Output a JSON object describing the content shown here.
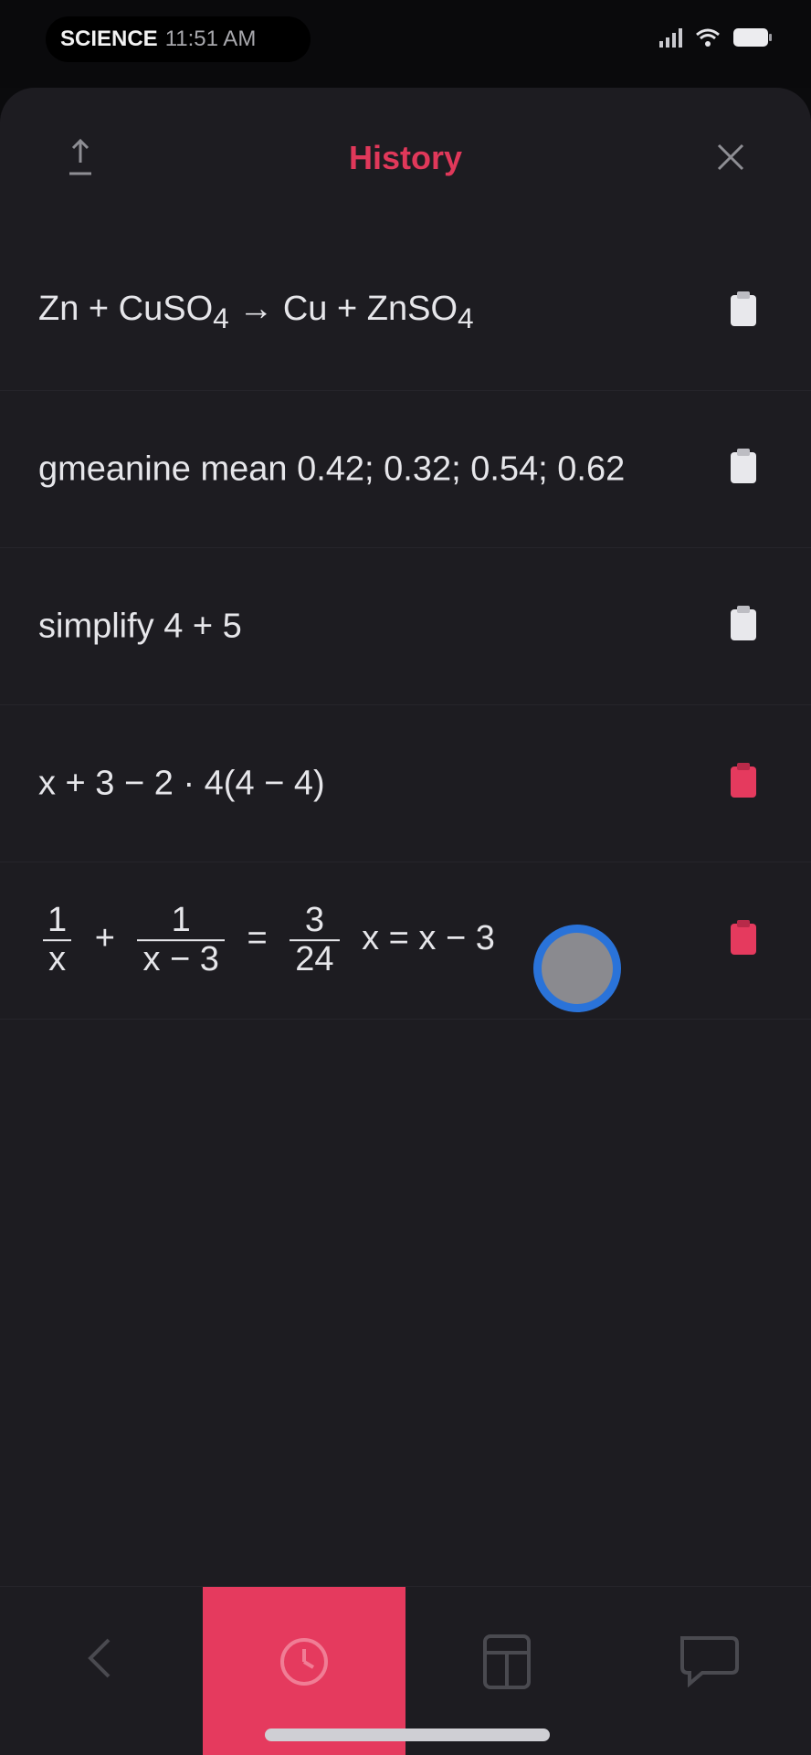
{
  "status_bar": {
    "app_name": "SCIENCE",
    "time_label": "11:51 AM",
    "icons": [
      "signal-icon",
      "wifi-icon",
      "battery-icon"
    ]
  },
  "header": {
    "title": "History",
    "left_icon": "upload-icon",
    "right_icon": "close-icon"
  },
  "history": {
    "items": [
      {
        "expr_parts": [
          "Zn + CuSO",
          "4",
          " → Cu + ZnSO",
          "4"
        ],
        "action_icon": "copy-icon",
        "action_color": "#e8e8ec"
      },
      {
        "expr": "gmeanine mean 0.42; 0.32; 0.54; 0.62",
        "action_icon": "copy-icon",
        "action_color": "#e8e8ec"
      },
      {
        "expr": "simplify 4 + 5",
        "action_icon": "copy-icon",
        "action_color": "#e8e8ec"
      },
      {
        "expr": "x + 3 − 2 · 4(4 − 4)",
        "action_icon": "delete-icon",
        "action_color": "#e53a5e"
      },
      {
        "frac1": {
          "num": "1",
          "den": "x"
        },
        "op1": "+",
        "frac2": {
          "num": "1",
          "den": "x − 3"
        },
        "op2": "=",
        "frac3": {
          "num": "3",
          "den": "24"
        },
        "tail": "x = x − 3",
        "action_icon": "delete-icon",
        "action_color": "#e53a5e"
      }
    ]
  },
  "bottom_nav": {
    "items": [
      {
        "icon": "back-icon",
        "active": false
      },
      {
        "icon": "history-icon",
        "active": true
      },
      {
        "icon": "calculator-icon",
        "active": false
      },
      {
        "icon": "chat-icon",
        "active": false
      }
    ],
    "active_color": "#e53a5e"
  },
  "colors": {
    "accent": "#e0385a",
    "background": "#1d1c21",
    "touch_ring": "#2a73d9"
  }
}
